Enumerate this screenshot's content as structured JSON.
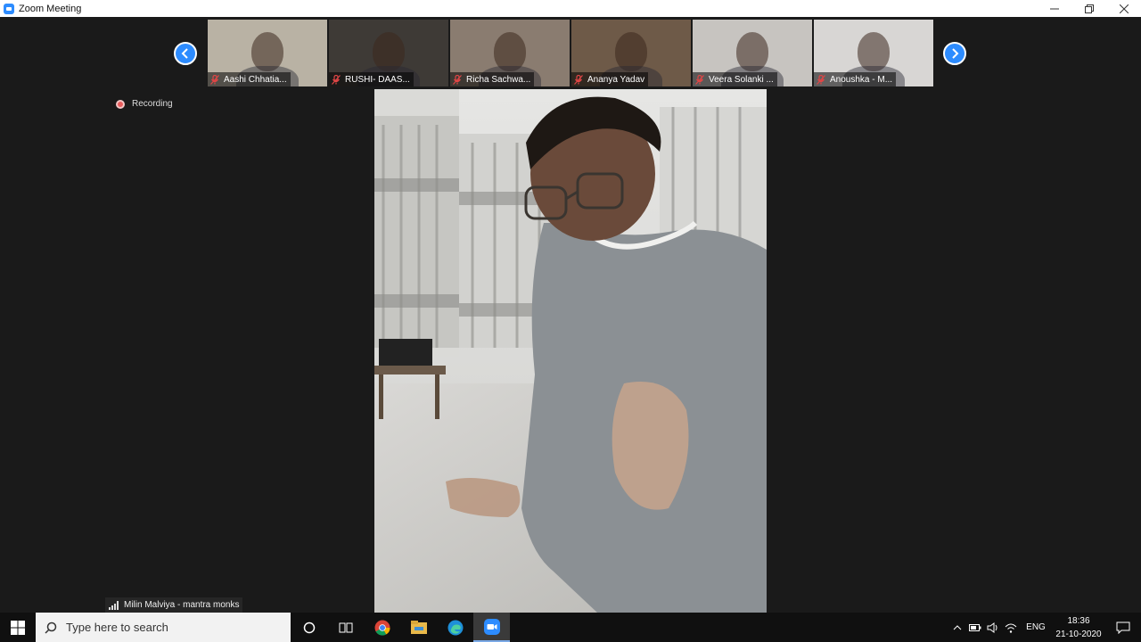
{
  "window": {
    "title": "Zoom Meeting",
    "minimize": "—",
    "restore": "❐",
    "close": "✕"
  },
  "gallery": {
    "prev_icon": "chevron-left",
    "next_icon": "chevron-right",
    "participants": [
      {
        "name": "Aashi Chhatia...",
        "muted": true,
        "bg": "#b9b2a4"
      },
      {
        "name": "RUSHI- DAAS...",
        "muted": true,
        "bg": "#3e3a36"
      },
      {
        "name": "Richa Sachwa...",
        "muted": true,
        "bg": "#8a7c70"
      },
      {
        "name": "Ananya Yadav",
        "muted": true,
        "bg": "#6e5a48"
      },
      {
        "name": "Veera Solanki ...",
        "muted": true,
        "bg": "#c7c4c0"
      },
      {
        "name": "Anoushka - M...",
        "muted": true,
        "bg": "#d8d6d4"
      }
    ]
  },
  "recording": {
    "label": "Recording",
    "color": "#e85b5b"
  },
  "active_speaker": {
    "name": "Milin Malviya - mantra monks"
  },
  "taskbar": {
    "search_placeholder": "Type here to search",
    "apps": [
      "chrome-icon",
      "file-explorer-icon",
      "edge-icon",
      "zoom-icon"
    ],
    "lang": "ENG",
    "time": "18:36",
    "date": "21-10-2020"
  },
  "colors": {
    "accent": "#2d8cff",
    "background": "#1a1a1a"
  }
}
